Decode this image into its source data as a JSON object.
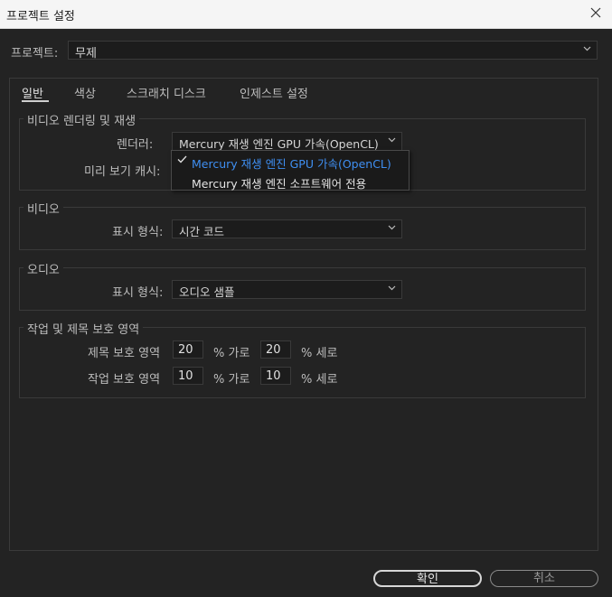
{
  "window": {
    "title": "프로젝트 설정"
  },
  "project": {
    "label": "프로젝트:",
    "value": "무제"
  },
  "tabs": [
    "일반",
    "색상",
    "스크래치 디스크",
    "인제스트 설정"
  ],
  "video_rendering": {
    "title": "비디오 렌더링 및 재생",
    "renderer_label": "렌더러:",
    "renderer_value": "Mercury 재생 엔진 GPU 가속(OpenCL)",
    "preview_cache_label": "미리 보기 캐시:",
    "options": [
      "Mercury 재생 엔진 GPU 가속(OpenCL)",
      "Mercury 재생 엔진 소프트웨어 전용"
    ]
  },
  "video": {
    "title": "비디오",
    "display_label": "표시 형식:",
    "display_value": "시간 코드"
  },
  "audio": {
    "title": "오디오",
    "display_label": "표시 형식:",
    "display_value": "오디오 샘플"
  },
  "safe_margins": {
    "title": "작업 및 제목 보호 영역",
    "title_safe_label": "제목 보호 영역",
    "title_h": "20",
    "title_v": "20",
    "action_safe_label": "작업 보호 영역",
    "action_h": "10",
    "action_v": "10",
    "h_unit": "% 가로",
    "v_unit": "% 세로"
  },
  "buttons": {
    "ok": "확인",
    "cancel": "취소"
  },
  "colors": {
    "accent": "#3f8ff2",
    "background": "#232323",
    "titlebar": "#f5f5f5"
  }
}
